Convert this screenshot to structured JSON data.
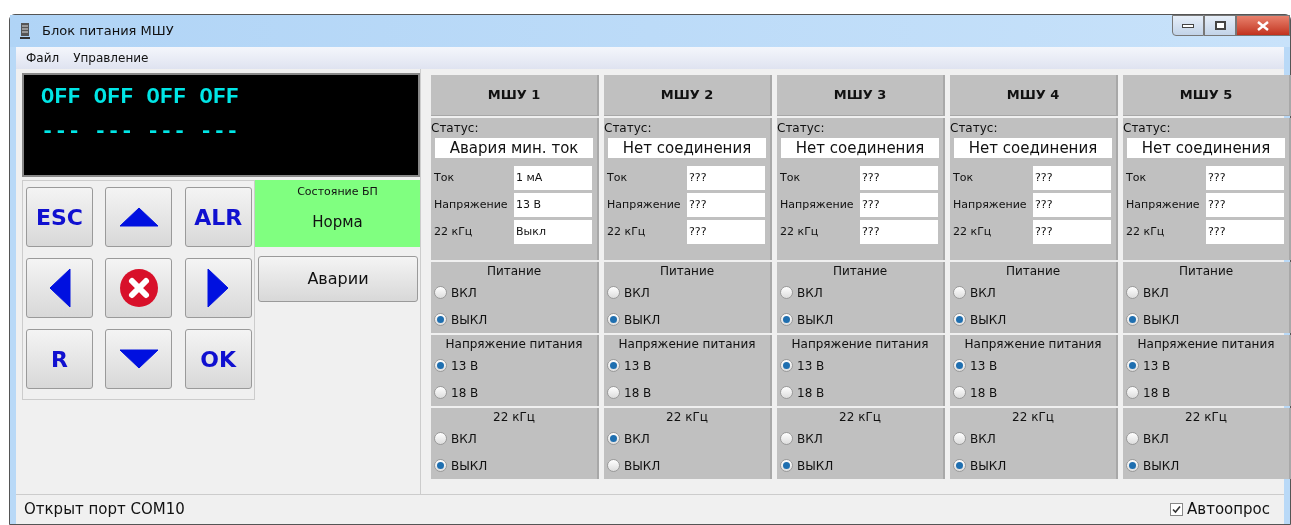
{
  "window": {
    "title": "Блок питания МШУ"
  },
  "menu": [
    "Файл",
    "Управление"
  ],
  "display": {
    "lines": [
      "OFF OFF OFF OFF",
      "--- --- --- ---"
    ]
  },
  "keypad": [
    {
      "kind": "text",
      "label": "ESC"
    },
    {
      "kind": "up"
    },
    {
      "kind": "text",
      "label": "ALR"
    },
    {
      "kind": "left"
    },
    {
      "kind": "cancel"
    },
    {
      "kind": "right"
    },
    {
      "kind": "text",
      "label": "R"
    },
    {
      "kind": "down"
    },
    {
      "kind": "text",
      "label": "OK"
    }
  ],
  "psu_state": {
    "title": "Состояние БП",
    "value": "Норма",
    "color": "#80ff80"
  },
  "alarms_button": "Аварии",
  "modules": [
    {
      "title": "МШУ 1",
      "status_label": "Статус:",
      "status": "Авария мин. ток",
      "fields": [
        {
          "label": "Ток",
          "value": "1 мА"
        },
        {
          "label": "Напряжение",
          "value": "13 В"
        },
        {
          "label": "22 кГц",
          "value": "Выкл"
        }
      ],
      "groups": [
        {
          "title": "Питание",
          "options": [
            {
              "label": "ВКЛ",
              "selected": false
            },
            {
              "label": "ВЫКЛ",
              "selected": true
            }
          ]
        },
        {
          "title": "Напряжение питания",
          "options": [
            {
              "label": "13 В",
              "selected": true
            },
            {
              "label": "18 В",
              "selected": false
            }
          ]
        },
        {
          "title": "22 кГц",
          "options": [
            {
              "label": "ВКЛ",
              "selected": false
            },
            {
              "label": "ВЫКЛ",
              "selected": true
            }
          ]
        }
      ]
    },
    {
      "title": "МШУ 2",
      "status_label": "Статус:",
      "status": "Нет соединения",
      "fields": [
        {
          "label": "Ток",
          "value": "???"
        },
        {
          "label": "Напряжение",
          "value": "???"
        },
        {
          "label": "22 кГц",
          "value": "???"
        }
      ],
      "groups": [
        {
          "title": "Питание",
          "options": [
            {
              "label": "ВКЛ",
              "selected": false
            },
            {
              "label": "ВЫКЛ",
              "selected": true
            }
          ]
        },
        {
          "title": "Напряжение питания",
          "options": [
            {
              "label": "13 В",
              "selected": true
            },
            {
              "label": "18 В",
              "selected": false
            }
          ]
        },
        {
          "title": "22 кГц",
          "options": [
            {
              "label": "ВКЛ",
              "selected": true
            },
            {
              "label": "ВЫКЛ",
              "selected": false
            }
          ]
        }
      ]
    },
    {
      "title": "МШУ 3",
      "status_label": "Статус:",
      "status": "Нет соединения",
      "fields": [
        {
          "label": "Ток",
          "value": "???"
        },
        {
          "label": "Напряжение",
          "value": "???"
        },
        {
          "label": "22 кГц",
          "value": "???"
        }
      ],
      "groups": [
        {
          "title": "Питание",
          "options": [
            {
              "label": "ВКЛ",
              "selected": false
            },
            {
              "label": "ВЫКЛ",
              "selected": true
            }
          ]
        },
        {
          "title": "Напряжение питания",
          "options": [
            {
              "label": "13 В",
              "selected": true
            },
            {
              "label": "18 В",
              "selected": false
            }
          ]
        },
        {
          "title": "22 кГц",
          "options": [
            {
              "label": "ВКЛ",
              "selected": false
            },
            {
              "label": "ВЫКЛ",
              "selected": true
            }
          ]
        }
      ]
    },
    {
      "title": "МШУ 4",
      "status_label": "Статус:",
      "status": "Нет соединения",
      "fields": [
        {
          "label": "Ток",
          "value": "???"
        },
        {
          "label": "Напряжение",
          "value": "???"
        },
        {
          "label": "22 кГц",
          "value": "???"
        }
      ],
      "groups": [
        {
          "title": "Питание",
          "options": [
            {
              "label": "ВКЛ",
              "selected": false
            },
            {
              "label": "ВЫКЛ",
              "selected": true
            }
          ]
        },
        {
          "title": "Напряжение питания",
          "options": [
            {
              "label": "13 В",
              "selected": true
            },
            {
              "label": "18 В",
              "selected": false
            }
          ]
        },
        {
          "title": "22 кГц",
          "options": [
            {
              "label": "ВКЛ",
              "selected": false
            },
            {
              "label": "ВЫКЛ",
              "selected": true
            }
          ]
        }
      ]
    },
    {
      "title": "МШУ 5",
      "status_label": "Статус:",
      "status": "Нет соединения",
      "fields": [
        {
          "label": "Ток",
          "value": "???"
        },
        {
          "label": "Напряжение",
          "value": "???"
        },
        {
          "label": "22 кГц",
          "value": "???"
        }
      ],
      "groups": [
        {
          "title": "Питание",
          "options": [
            {
              "label": "ВКЛ",
              "selected": false
            },
            {
              "label": "ВЫКЛ",
              "selected": true
            }
          ]
        },
        {
          "title": "Напряжение питания",
          "options": [
            {
              "label": "13 В",
              "selected": true
            },
            {
              "label": "18 В",
              "selected": false
            }
          ]
        },
        {
          "title": "22 кГц",
          "options": [
            {
              "label": "ВКЛ",
              "selected": false
            },
            {
              "label": "ВЫКЛ",
              "selected": true
            }
          ]
        }
      ]
    }
  ],
  "status_bar": {
    "text": "Открыт порт COM10",
    "autopoll": {
      "label": "Автоопрос",
      "checked": true
    }
  }
}
